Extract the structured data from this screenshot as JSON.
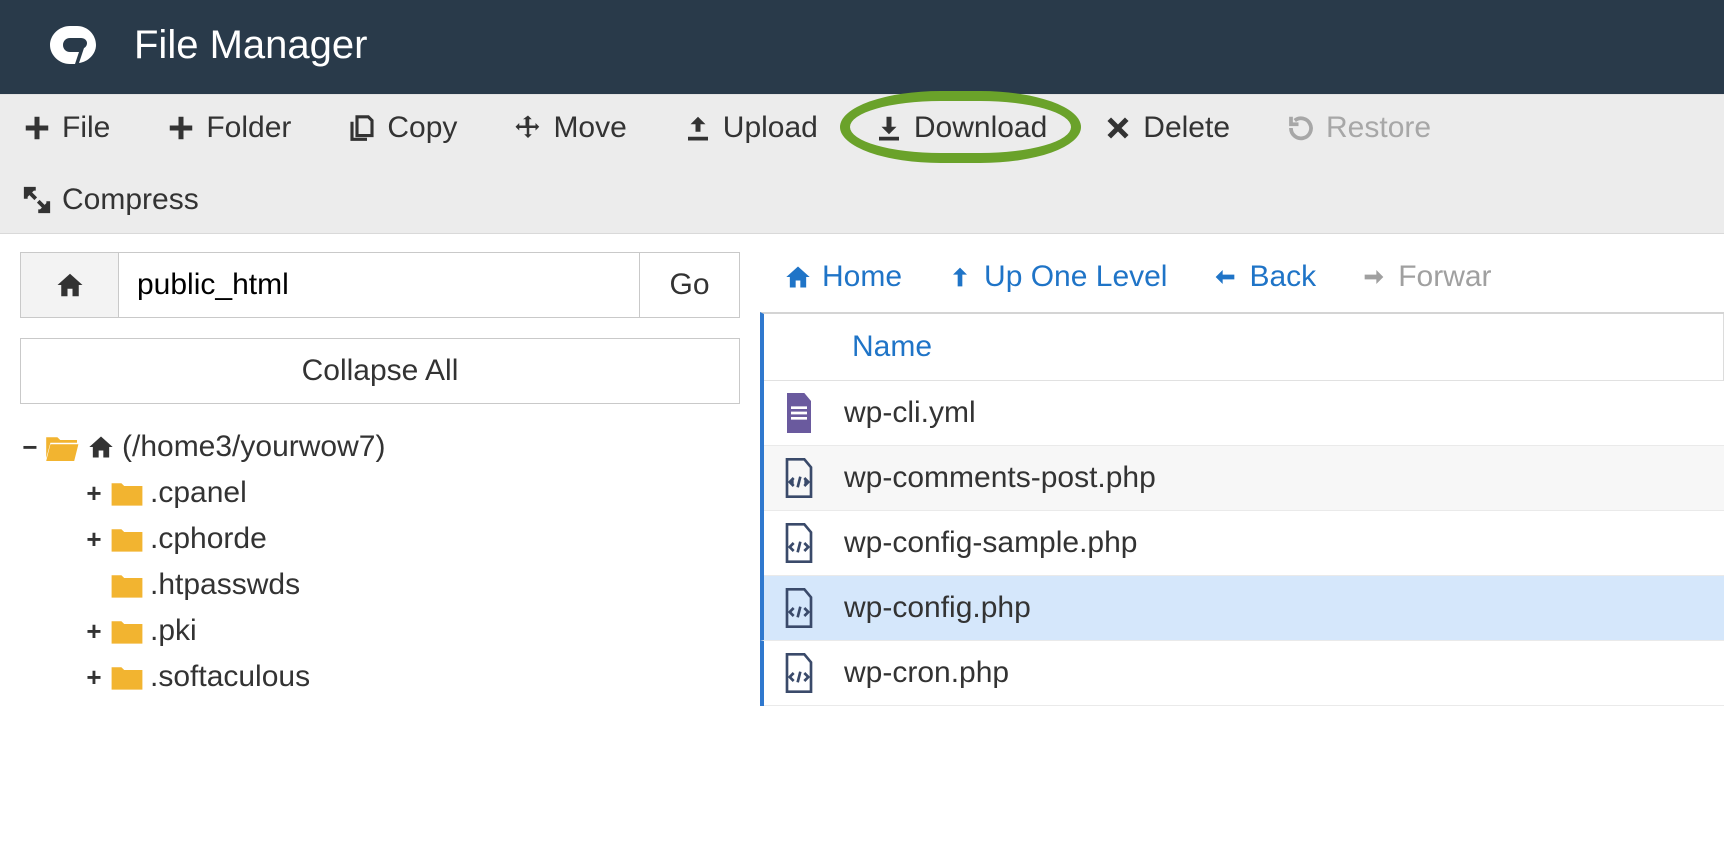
{
  "header": {
    "title": "File Manager"
  },
  "toolbar": {
    "file": "File",
    "folder": "Folder",
    "copy": "Copy",
    "move": "Move",
    "upload": "Upload",
    "download": "Download",
    "delete": "Delete",
    "restore": "Restore",
    "compress": "Compress",
    "highlighted": "download"
  },
  "path": {
    "value": "public_html",
    "go_label": "Go"
  },
  "collapse_label": "Collapse All",
  "tree": {
    "root_label": "(/home3/yourwow7)",
    "children": [
      {
        "label": ".cpanel",
        "expandable": true
      },
      {
        "label": ".cphorde",
        "expandable": true
      },
      {
        "label": ".htpasswds",
        "expandable": false
      },
      {
        "label": ".pki",
        "expandable": true
      },
      {
        "label": ".softaculous",
        "expandable": true
      }
    ]
  },
  "nav": {
    "home": "Home",
    "up": "Up One Level",
    "back": "Back",
    "forward": "Forwar"
  },
  "table": {
    "column_name": "Name",
    "rows": [
      {
        "name": "wp-cli.yml",
        "type": "doc",
        "selected": false
      },
      {
        "name": "wp-comments-post.php",
        "type": "code",
        "selected": false
      },
      {
        "name": "wp-config-sample.php",
        "type": "code",
        "selected": false
      },
      {
        "name": "wp-config.php",
        "type": "code",
        "selected": true
      },
      {
        "name": "wp-cron.php",
        "type": "code",
        "selected": false
      }
    ]
  }
}
